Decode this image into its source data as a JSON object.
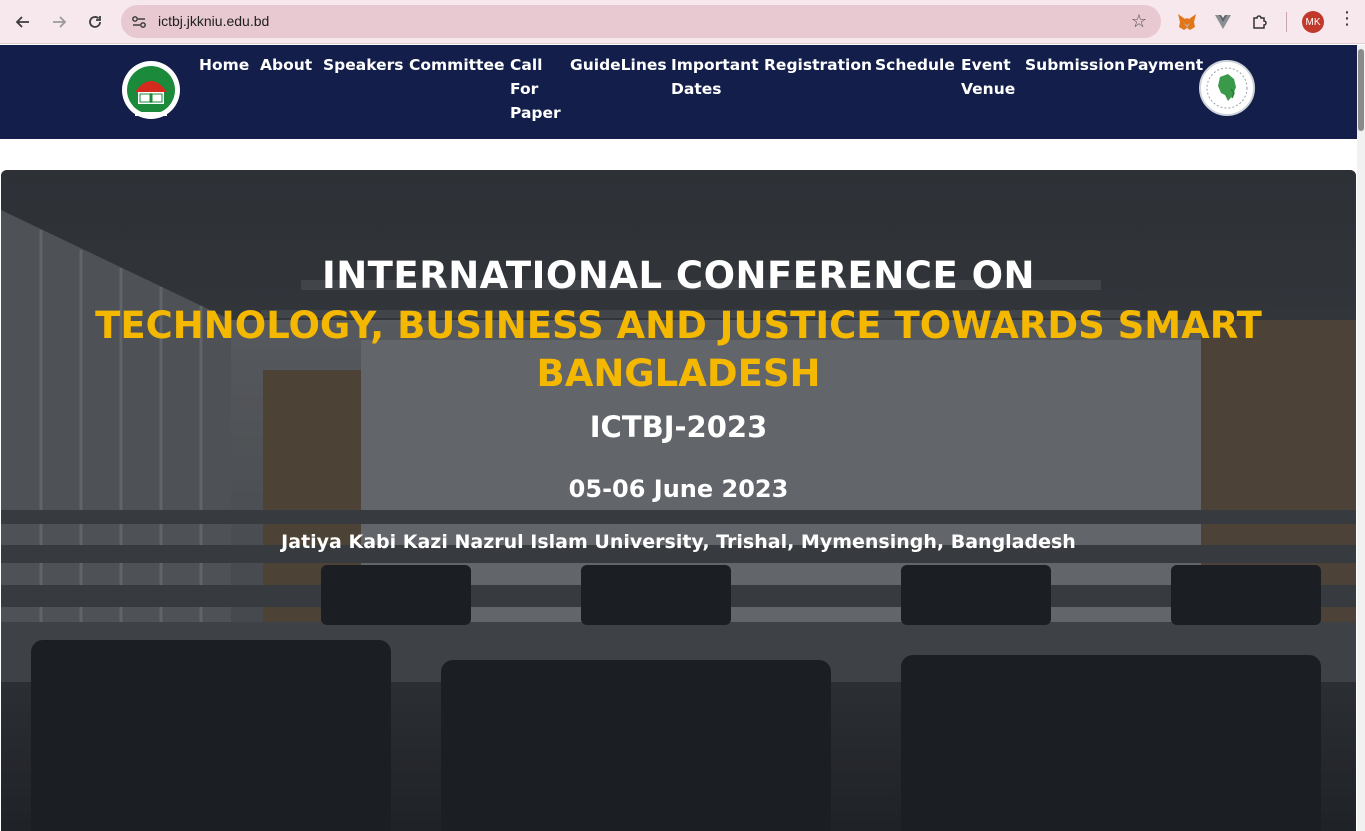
{
  "browser": {
    "url": "ictbj.jkkniu.edu.bd",
    "profile_initials": "MK",
    "icons": {
      "back": "arrow-left-icon",
      "forward": "arrow-right-icon",
      "reload": "reload-icon",
      "site_info": "tune-icon",
      "bookmark": "star-icon",
      "extension_metamask": "fox-icon",
      "extension_vue": "v-icon",
      "extensions": "puzzle-icon",
      "menu": "kebab-icon"
    }
  },
  "header": {
    "left_logo": "university-logo",
    "right_logo": "conference-seal-logo",
    "menu": [
      {
        "label": "Home"
      },
      {
        "label": "About"
      },
      {
        "label": "Speakers"
      },
      {
        "label": "Committee"
      },
      {
        "label": "Call\nFor\nPaper"
      },
      {
        "label": "GuideLines"
      },
      {
        "label": "Important\nDates"
      },
      {
        "label": "Registration"
      },
      {
        "label": "Schedule"
      },
      {
        "label": "Event\nVenue"
      },
      {
        "label": "Submission"
      },
      {
        "label": "Payment"
      }
    ]
  },
  "hero": {
    "title_line1": "INTERNATIONAL CONFERENCE ON",
    "title_line2": "TECHNOLOGY, BUSINESS AND JUSTICE TOWARDS SMART BANGLADESH",
    "code": "ICTBJ-2023",
    "date": "05-06 June 2023",
    "venue": "Jatiya Kabi Kazi Nazrul Islam University, Trishal, Mymensingh, Bangladesh"
  },
  "colors": {
    "header_bg": "#131f4a",
    "accent_yellow": "#f5b800",
    "chrome_bg": "#f6e8ec",
    "omnibox_bg": "#e8c9d1"
  }
}
